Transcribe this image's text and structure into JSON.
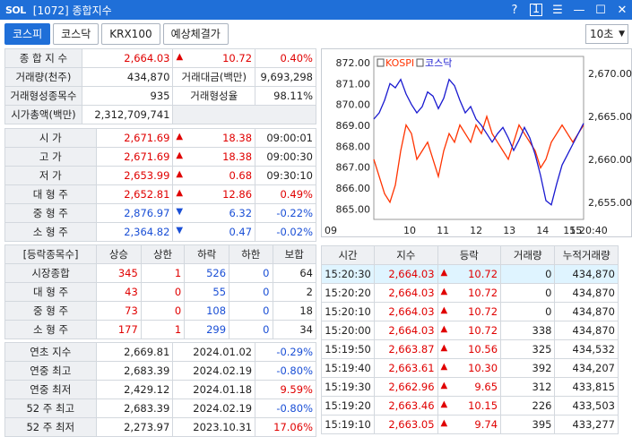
{
  "window": {
    "logo": "SOL",
    "title": "[1072] 종합지수",
    "help": "?",
    "one": "1"
  },
  "tabs": [
    "코스피",
    "코스닥",
    "KRX100",
    "예상체결가"
  ],
  "interval": "10초",
  "summary": {
    "rows": [
      {
        "l1": "종 합 지 수",
        "v1": "2,664.03",
        "arrow": "▲",
        "chg": "10.72",
        "pct": "0.40%"
      },
      {
        "l1": "거래량(천주)",
        "v1": "434,870",
        "l2": "거래대금(백만)",
        "v2": "9,693,298"
      },
      {
        "l1": "거래형성종목수",
        "v1": "935",
        "l2": "거래형성율",
        "v2": "98.11%"
      },
      {
        "l1": "시가총액(백만)",
        "v1": "2,312,709,741"
      }
    ]
  },
  "ohlc": [
    {
      "label": "시 가",
      "value": "2,671.69",
      "arrow": "▲",
      "chg": "18.38",
      "time": "09:00:01",
      "color": "red"
    },
    {
      "label": "고 가",
      "value": "2,671.69",
      "arrow": "▲",
      "chg": "18.38",
      "time": "09:00:30",
      "color": "red"
    },
    {
      "label": "저 가",
      "value": "2,653.99",
      "arrow": "▲",
      "chg": "0.68",
      "time": "09:30:10",
      "color": "red"
    },
    {
      "label": "대 형 주",
      "value": "2,652.81",
      "arrow": "▲",
      "chg": "12.86",
      "time": "0.49%",
      "color": "red"
    },
    {
      "label": "중 형 주",
      "value": "2,876.97",
      "arrow": "▼",
      "chg": "6.32",
      "time": "-0.22%",
      "color": "blue"
    },
    {
      "label": "소 형 주",
      "value": "2,364.82",
      "arrow": "▼",
      "chg": "0.47",
      "time": "-0.02%",
      "color": "blue"
    }
  ],
  "breadth": {
    "headers": [
      "[등락종목수]",
      "상승",
      "상한",
      "하락",
      "하한",
      "보합"
    ],
    "rows": [
      {
        "label": "시장종합",
        "up": "345",
        "uplim": "1",
        "dn": "526",
        "dnlim": "0",
        "flat": "64"
      },
      {
        "label": "대 형 주",
        "up": "43",
        "uplim": "0",
        "dn": "55",
        "dnlim": "0",
        "flat": "2"
      },
      {
        "label": "중 형 주",
        "up": "73",
        "uplim": "0",
        "dn": "108",
        "dnlim": "0",
        "flat": "18"
      },
      {
        "label": "소 형 주",
        "up": "177",
        "uplim": "1",
        "dn": "299",
        "dnlim": "0",
        "flat": "34"
      }
    ]
  },
  "yearly": [
    {
      "label": "연초 지수",
      "value": "2,669.81",
      "date": "2024.01.02",
      "pct": "-0.29%",
      "color": "blue"
    },
    {
      "label": "연중 최고",
      "value": "2,683.39",
      "date": "2024.02.19",
      "pct": "-0.80%",
      "color": "blue"
    },
    {
      "label": "연중 최저",
      "value": "2,429.12",
      "date": "2024.01.18",
      "pct": "9.59%",
      "color": "red"
    },
    {
      "label": "52 주 최고",
      "value": "2,683.39",
      "date": "2024.02.19",
      "pct": "-0.80%",
      "color": "blue"
    },
    {
      "label": "52 주 최저",
      "value": "2,273.97",
      "date": "2023.10.31",
      "pct": "17.06%",
      "color": "red"
    }
  ],
  "ticks": {
    "headers": [
      "시간",
      "지수",
      "등락",
      "거래량",
      "누적거래량"
    ],
    "rows": [
      {
        "time": "15:20:30",
        "idx": "2,664.03",
        "chg": "10.72",
        "vol": "0",
        "cum": "434,870"
      },
      {
        "time": "15:20:20",
        "idx": "2,664.03",
        "chg": "10.72",
        "vol": "0",
        "cum": "434,870"
      },
      {
        "time": "15:20:10",
        "idx": "2,664.03",
        "chg": "10.72",
        "vol": "0",
        "cum": "434,870"
      },
      {
        "time": "15:20:00",
        "idx": "2,664.03",
        "chg": "10.72",
        "vol": "338",
        "cum": "434,870"
      },
      {
        "time": "15:19:50",
        "idx": "2,663.87",
        "chg": "10.56",
        "vol": "325",
        "cum": "434,532"
      },
      {
        "time": "15:19:40",
        "idx": "2,663.61",
        "chg": "10.30",
        "vol": "392",
        "cum": "434,207"
      },
      {
        "time": "15:19:30",
        "idx": "2,662.96",
        "chg": "9.65",
        "vol": "312",
        "cum": "433,815"
      },
      {
        "time": "15:19:20",
        "idx": "2,663.46",
        "chg": "10.15",
        "vol": "226",
        "cum": "433,503"
      },
      {
        "time": "15:19:10",
        "idx": "2,663.05",
        "chg": "9.74",
        "vol": "395",
        "cum": "433,277"
      }
    ]
  },
  "chart_data": {
    "type": "line",
    "series": [
      {
        "name": "KOSPI",
        "color": "#ff3300",
        "axis": "right",
        "values": [
          2660,
          2658,
          2656,
          2655,
          2657,
          2661,
          2664,
          2663,
          2660,
          2661,
          2662,
          2660,
          2658,
          2661,
          2663,
          2662,
          2664,
          2663,
          2662,
          2664,
          2663,
          2665,
          2663,
          2662,
          2661,
          2660,
          2662,
          2664,
          2663,
          2662,
          2661,
          2659,
          2660,
          2662,
          2663,
          2664,
          2663,
          2662,
          2663,
          2664
        ]
      },
      {
        "name": "코스닥",
        "color": "#1a1ad0",
        "axis": "left",
        "values": [
          869.3,
          869.6,
          870.2,
          871.0,
          870.8,
          871.2,
          870.5,
          870.0,
          869.6,
          869.9,
          870.6,
          870.4,
          869.8,
          870.3,
          871.2,
          870.9,
          870.2,
          869.6,
          869.9,
          869.3,
          869.0,
          868.6,
          868.2,
          868.6,
          868.9,
          868.4,
          867.8,
          868.3,
          868.9,
          868.4,
          867.6,
          866.6,
          865.4,
          865.2,
          866.2,
          867.1,
          867.6,
          868.1,
          868.6,
          869.1
        ]
      }
    ],
    "x_ticks": [
      "09",
      "10",
      "11",
      "12",
      "13",
      "14",
      "15",
      "15:20:40"
    ],
    "left_ticks": [
      "872.00",
      "871.00",
      "870.00",
      "869.00",
      "868.00",
      "867.00",
      "866.00",
      "865.00"
    ],
    "right_ticks": [
      "2,670.00",
      "2,665.00",
      "2,660.00",
      "2,655.00"
    ],
    "ylim_left": [
      864.5,
      872.3
    ],
    "ylim_right": [
      2653,
      2672
    ]
  }
}
